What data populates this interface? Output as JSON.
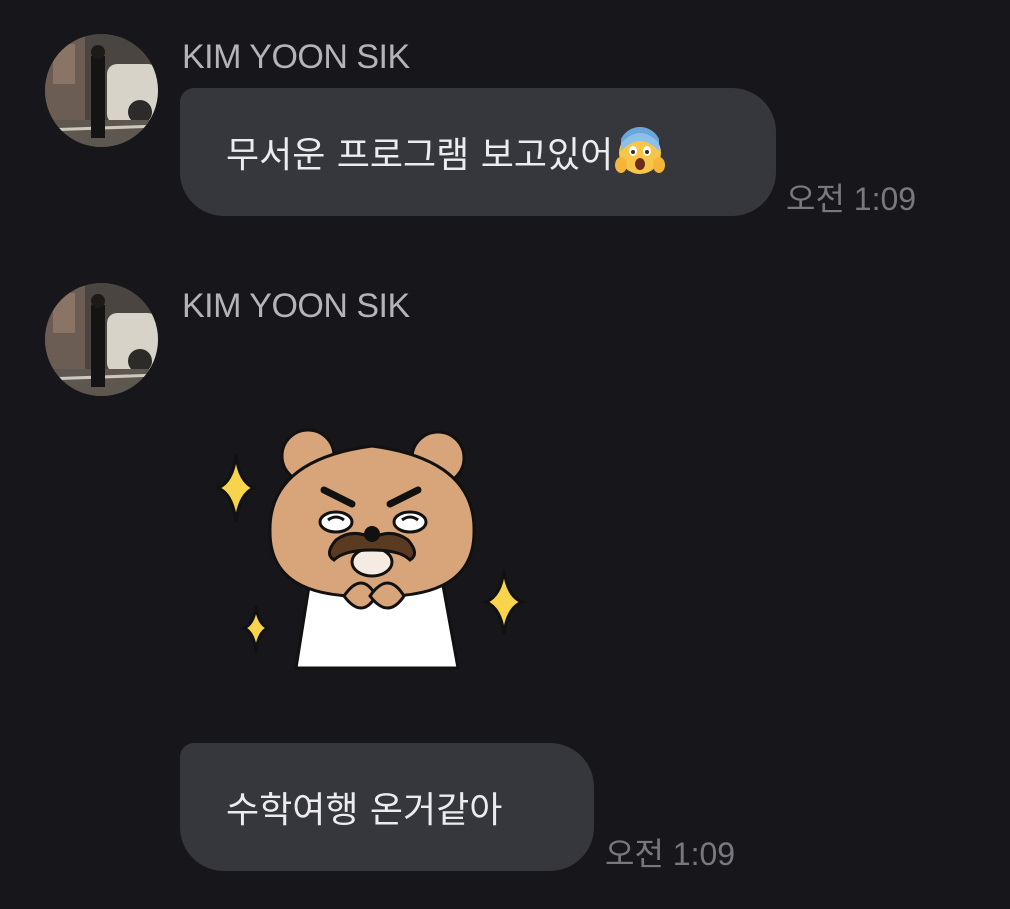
{
  "messages": [
    {
      "sender": "KIM YOON SIK",
      "text": "무서운 프로그램 보고있어",
      "emoji": "screaming-face-emoji",
      "time": "오전 1:09"
    },
    {
      "sender": "KIM YOON SIK",
      "sticker": "bear-sticker-mustache-sparkles",
      "text": "수학여행 온거같아",
      "time": "오전 1:09"
    }
  ],
  "colors": {
    "background": "#17171b",
    "bubble": "#36373d",
    "bubble_text": "#ececef",
    "sender_text": "#b3b3b8",
    "time_text": "#78787e"
  }
}
